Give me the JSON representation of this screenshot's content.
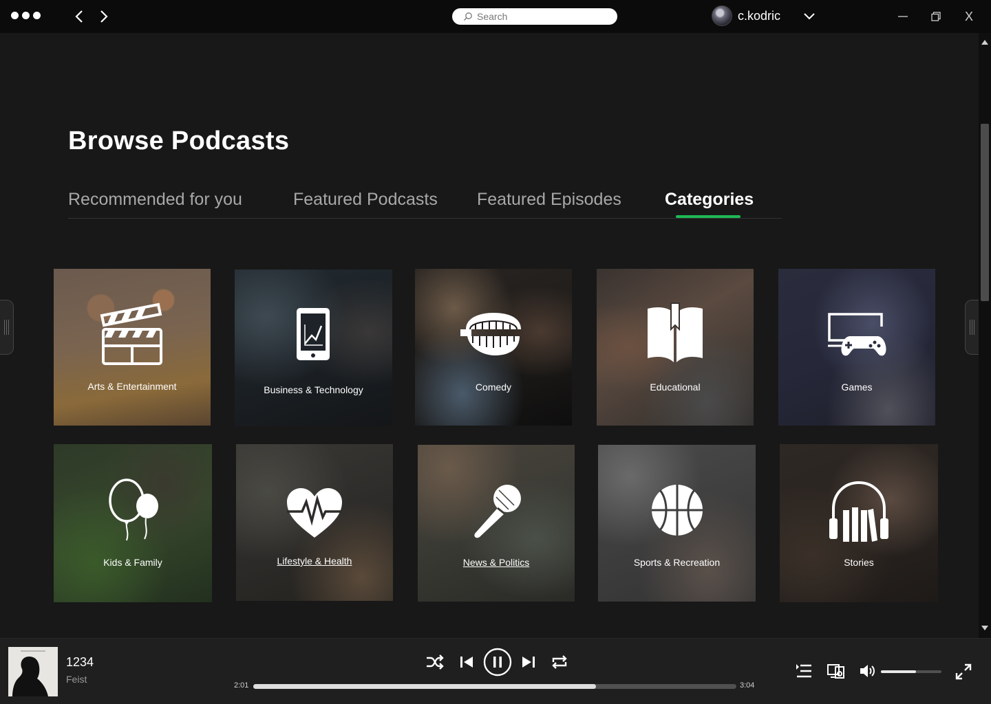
{
  "titlebar": {
    "search_placeholder": "Search",
    "username": "c.kodric",
    "close_label": "X"
  },
  "page": {
    "title": "Browse Podcasts",
    "tabs": [
      {
        "label": "Recommended for you",
        "active": false
      },
      {
        "label": "Featured Podcasts",
        "active": false
      },
      {
        "label": "Featured Episodes",
        "active": false
      },
      {
        "label": "Categories",
        "active": true
      }
    ]
  },
  "categories": [
    {
      "label": "Arts & Entertainment",
      "icon": "clapperboard-icon"
    },
    {
      "label": "Business & Technology",
      "icon": "tablet-chart-icon"
    },
    {
      "label": "Comedy",
      "icon": "chattering-teeth-icon"
    },
    {
      "label": "Educational",
      "icon": "open-book-icon"
    },
    {
      "label": "Games",
      "icon": "monitor-gamepad-icon"
    },
    {
      "label": "Kids & Family",
      "icon": "balloons-icon"
    },
    {
      "label": "Lifestyle & Health",
      "icon": "heartbeat-icon"
    },
    {
      "label": "News & Politics",
      "icon": "microphone-icon"
    },
    {
      "label": "Sports & Recreation",
      "icon": "basketball-icon"
    },
    {
      "label": "Stories",
      "icon": "headphones-books-icon"
    }
  ],
  "player": {
    "track_title": "1234",
    "artist": "Feist",
    "elapsed": "2:01",
    "duration": "3:04",
    "progress_fraction": 0.71,
    "volume_fraction": 0.58
  },
  "colors": {
    "accent": "#1db954",
    "background": "#181818",
    "titlebar": "#0b0b0b",
    "player": "#1f1f1f"
  }
}
